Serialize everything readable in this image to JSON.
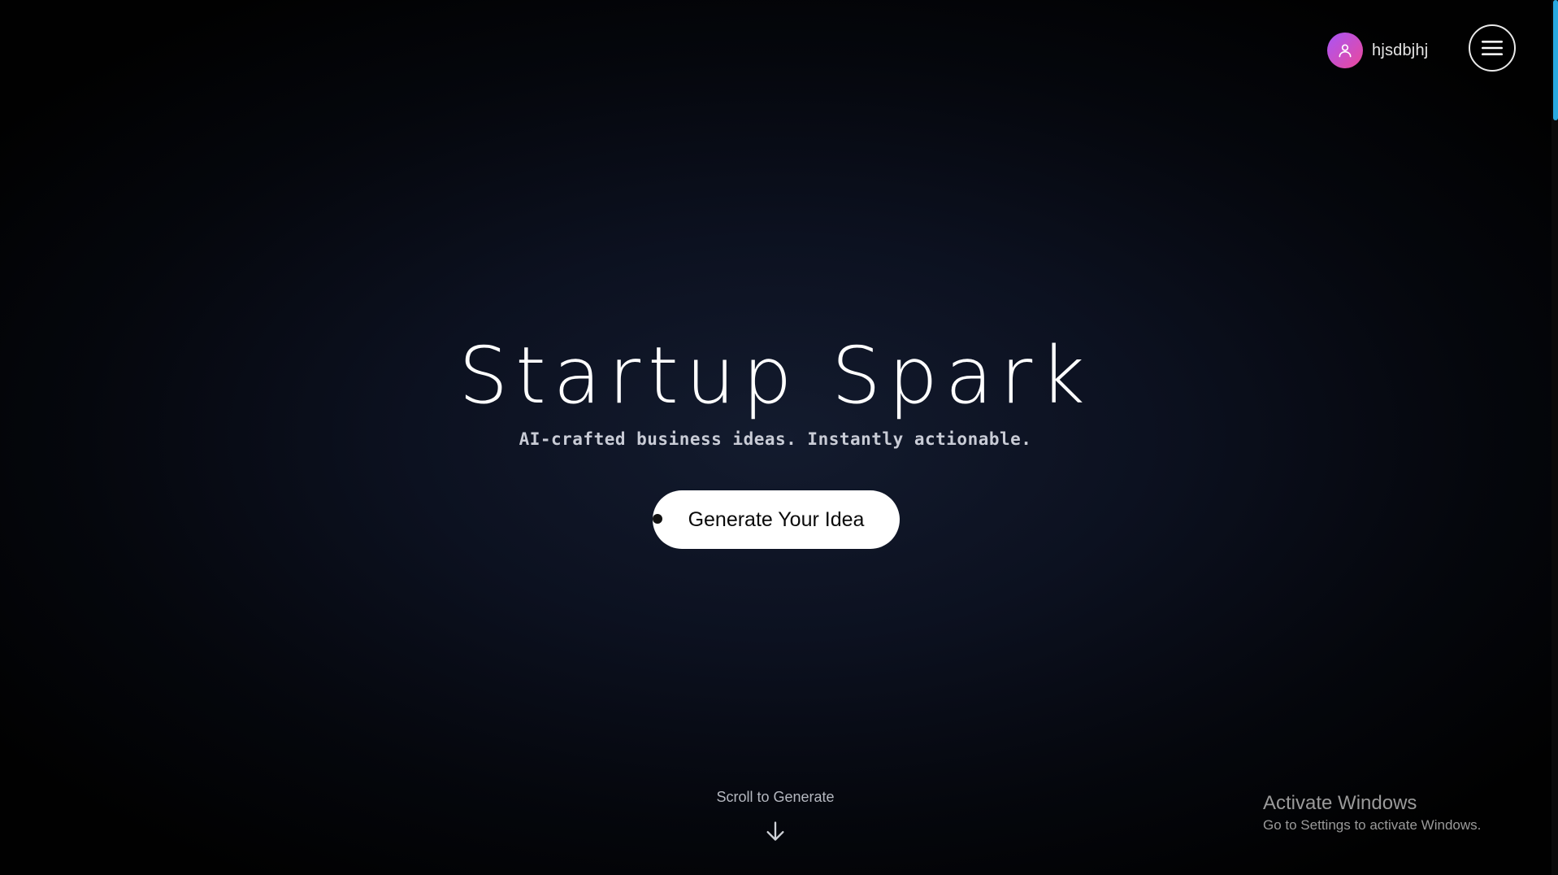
{
  "header": {
    "username": "hjsdbjhj",
    "avatar_icon": "user-icon",
    "menu_icon": "hamburger-menu-icon"
  },
  "hero": {
    "title": "Startup Spark",
    "subtitle": "AI-crafted business ideas. Instantly actionable.",
    "cta_label": "Generate Your Idea"
  },
  "footer": {
    "scroll_hint": "Scroll to Generate",
    "scroll_icon": "arrow-down-icon"
  },
  "os_watermark": {
    "title": "Activate Windows",
    "subtitle": "Go to Settings to activate Windows."
  },
  "colors": {
    "background": "#000000",
    "accent_scrollbar": "#29a9e0",
    "avatar_gradient_start": "#a855f7",
    "avatar_gradient_end": "#ec4899",
    "cta_background": "#ffffff"
  }
}
